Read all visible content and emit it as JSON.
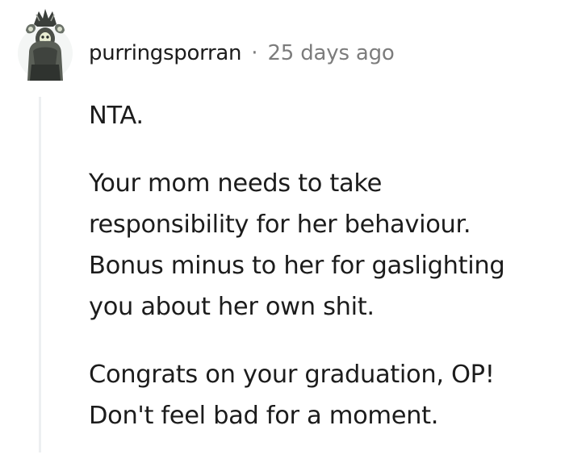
{
  "comment": {
    "username": "purringsporran",
    "separator": "·",
    "timestamp": "25 days ago",
    "avatar_icon": "user-avatar-icon",
    "paragraphs": [
      [
        "NTA."
      ],
      [
        "Your mom needs to take",
        "responsibility for her behaviour.",
        "Bonus minus to her for gaslighting",
        "you about her own shit."
      ],
      [
        "Congrats on your graduation, OP!",
        "Don't feel bad for a moment."
      ]
    ]
  }
}
